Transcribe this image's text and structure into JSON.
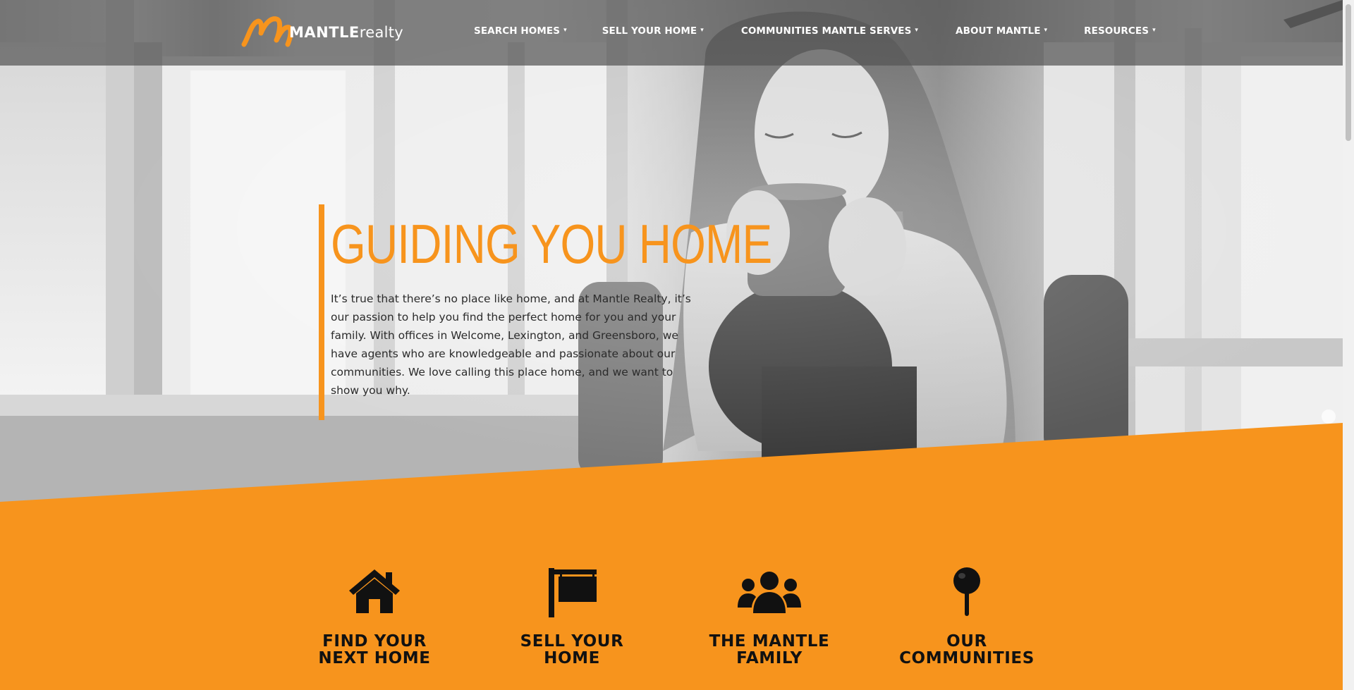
{
  "brand": {
    "logo_strong": "MANTLE",
    "logo_light": "realty",
    "accent": "#f7941d",
    "nav_bg": "#555555"
  },
  "nav": {
    "items": [
      {
        "label": "SEARCH HOMES"
      },
      {
        "label": "SELL YOUR HOME"
      },
      {
        "label": "COMMUNITIES MANTLE SERVES"
      },
      {
        "label": "ABOUT MANTLE"
      },
      {
        "label": "RESOURCES"
      }
    ],
    "chevron": "⌄"
  },
  "hero": {
    "title": "GUIDING YOU HOME",
    "copy": "It’s true that there’s no place like home, and at Mantle Realty, it’s our passion to help you find the perfect home for you and your family. With offices in Welcome, Lexington, and Greensboro, we have agents who are knowledgeable and passionate about our communities. We love calling this place home, and we want to show you why."
  },
  "features": [
    {
      "icon": "house-icon",
      "line1": "FIND YOUR",
      "line2": "NEXT HOME"
    },
    {
      "icon": "sign-post-icon",
      "line1": "SELL YOUR",
      "line2": "HOME"
    },
    {
      "icon": "people-icon",
      "line1": "THE MANTLE",
      "line2": "FAMILY"
    },
    {
      "icon": "map-pin-icon",
      "line1": "OUR",
      "line2": "COMMUNITIES"
    }
  ]
}
